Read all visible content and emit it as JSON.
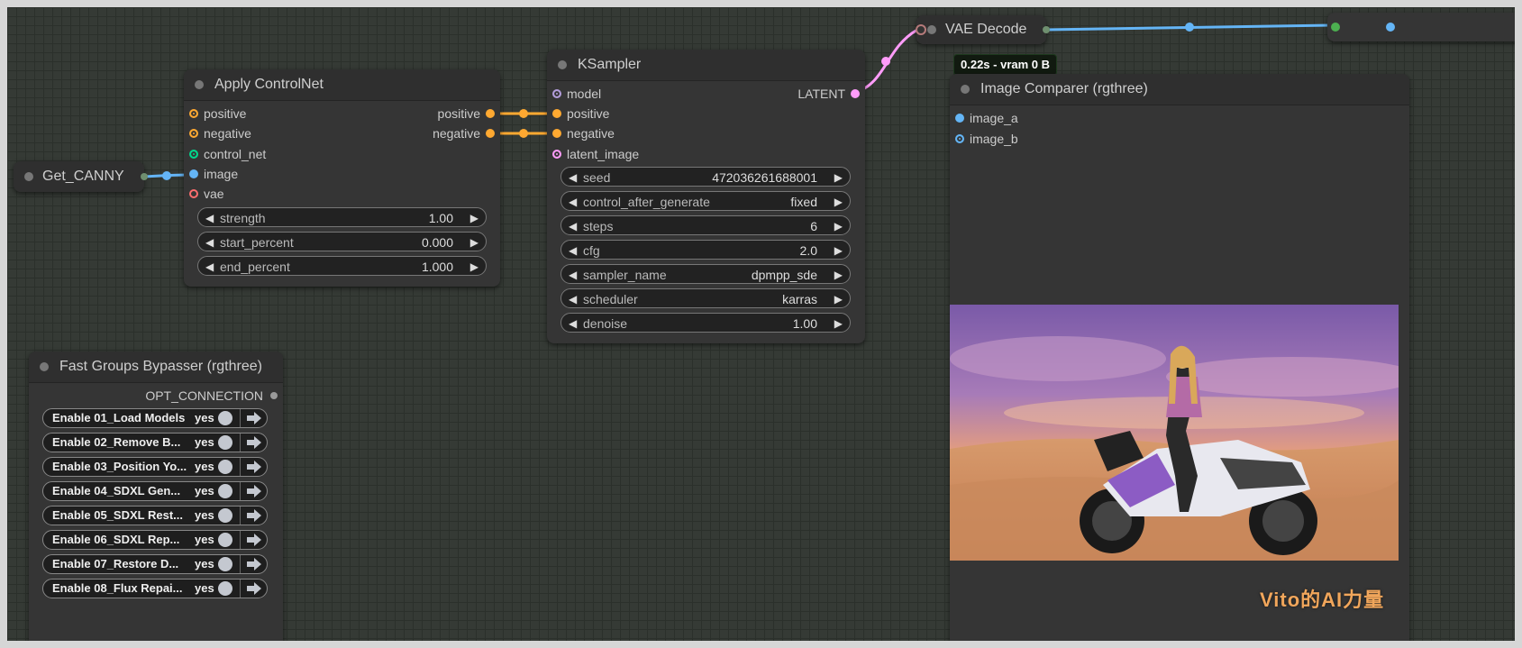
{
  "colors": {
    "canvas_bg": "#353a35",
    "node_bg": "#353535",
    "conditioning": "#ffa931",
    "image": "#64b5f6",
    "control_net": "#00d78d",
    "vae": "#ff6e6e",
    "model": "#b39ddb",
    "latent": "#ff9cf9",
    "wire_blue": "#64b5f6",
    "wire_pink": "#ff9cf9",
    "wire_orange": "#ffa931",
    "stats_text": "#ffffff",
    "watermark": "#f1a65b"
  },
  "get_canny": {
    "title": "Get_CANNY"
  },
  "apply_controlnet": {
    "title": "Apply ControlNet",
    "inputs": [
      "positive",
      "negative",
      "control_net",
      "image",
      "vae"
    ],
    "outputs": [
      "positive",
      "negative"
    ],
    "widgets": [
      {
        "label": "strength",
        "value": "1.00"
      },
      {
        "label": "start_percent",
        "value": "0.000"
      },
      {
        "label": "end_percent",
        "value": "1.000"
      }
    ]
  },
  "ksampler": {
    "title": "KSampler",
    "inputs": [
      "model",
      "positive",
      "negative",
      "latent_image"
    ],
    "outputs": [
      "LATENT"
    ],
    "widgets": [
      {
        "label": "seed",
        "value": "472036261688001"
      },
      {
        "label": "control_after_generate",
        "value": "fixed"
      },
      {
        "label": "steps",
        "value": "6"
      },
      {
        "label": "cfg",
        "value": "2.0"
      },
      {
        "label": "sampler_name",
        "value": "dpmpp_sde"
      },
      {
        "label": "scheduler",
        "value": "karras"
      },
      {
        "label": "denoise",
        "value": "1.00"
      }
    ]
  },
  "vae_decode": {
    "title": "VAE Decode",
    "stats": "0.22s - vram 0 B"
  },
  "image_comparer": {
    "title": "Image Comparer (rgthree)",
    "inputs": [
      "image_a",
      "image_b"
    ]
  },
  "fast_groups": {
    "title": "Fast Groups Bypasser (rgthree)",
    "output": "OPT_CONNECTION",
    "rows": [
      {
        "label": "Enable 01_Load Models",
        "state": "yes"
      },
      {
        "label": "Enable 02_Remove B...",
        "state": "yes"
      },
      {
        "label": "Enable 03_Position Yo...",
        "state": "yes"
      },
      {
        "label": "Enable 04_SDXL Gen...",
        "state": "yes"
      },
      {
        "label": "Enable 05_SDXL Rest...",
        "state": "yes"
      },
      {
        "label": "Enable 06_SDXL Rep...",
        "state": "yes"
      },
      {
        "label": "Enable 07_Restore D...",
        "state": "yes"
      },
      {
        "label": "Enable 08_Flux Repai...",
        "state": "yes"
      }
    ]
  },
  "watermark": "Vito的AI力量"
}
